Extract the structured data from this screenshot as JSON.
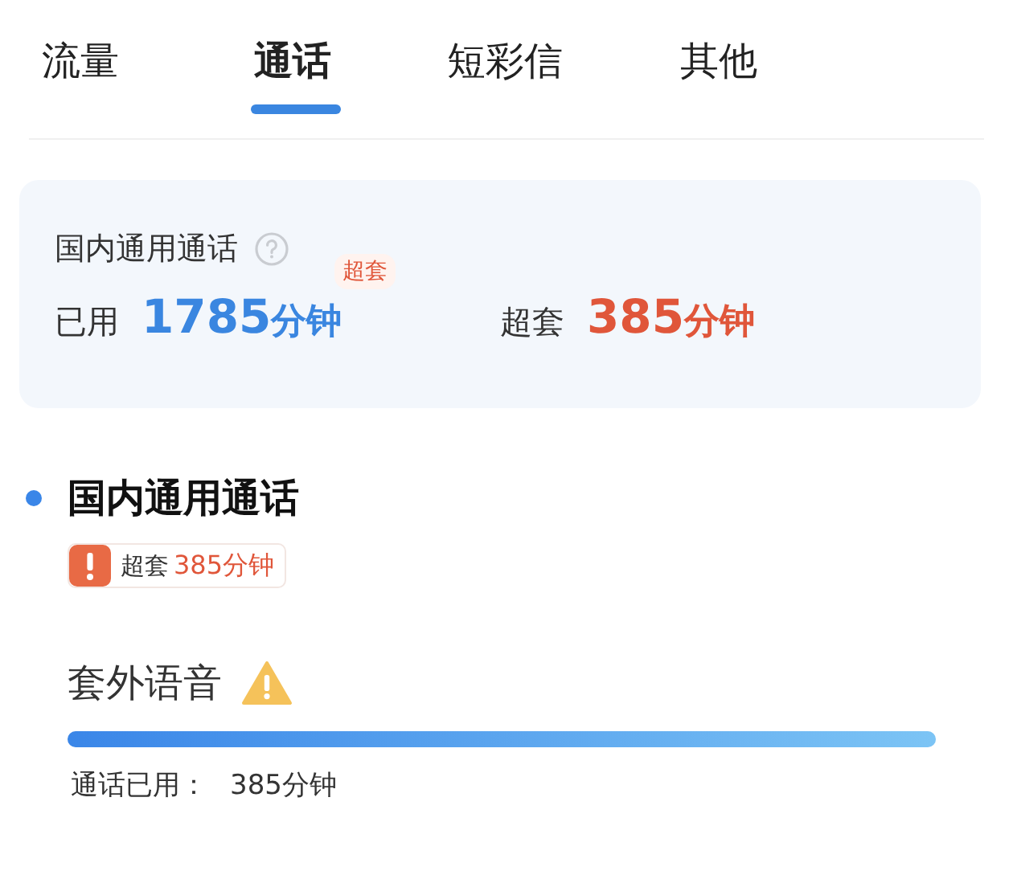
{
  "tabs": [
    {
      "label": "流量",
      "selected": false
    },
    {
      "label": "通话",
      "selected": true
    },
    {
      "label": "短彩信",
      "selected": false
    },
    {
      "label": "其他",
      "selected": false
    }
  ],
  "summary": {
    "title": "国内通用通话",
    "used_label": "已用",
    "used_value": "1785",
    "used_unit": "分钟",
    "over_badge": "超套",
    "over_label": "超套",
    "over_value": "385",
    "over_unit": "分钟"
  },
  "section": {
    "title": "国内通用通话",
    "alert_label": "超套",
    "alert_value": "385分钟",
    "item": {
      "name": "套外语音",
      "warning": true,
      "level": 1,
      "used_label": "通话已用：",
      "used_value": "385分钟"
    }
  }
}
